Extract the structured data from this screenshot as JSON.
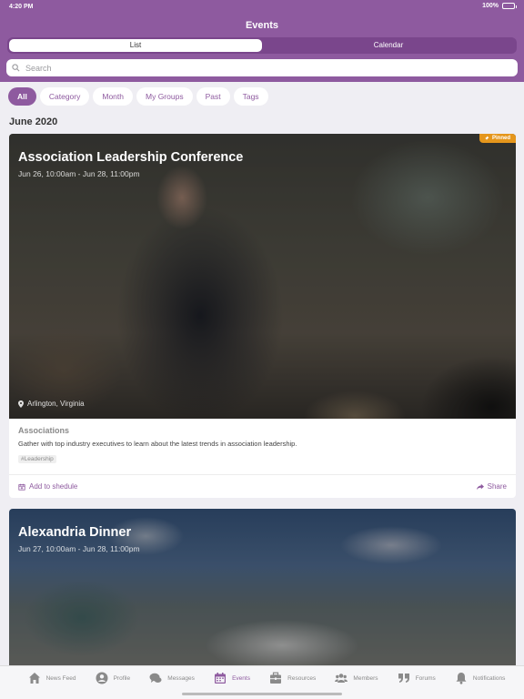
{
  "status": {
    "time": "4:20 PM",
    "battery": "100%"
  },
  "header": {
    "title": "Events"
  },
  "segment": {
    "list": "List",
    "calendar": "Calendar"
  },
  "search": {
    "placeholder": "Search"
  },
  "filters": [
    "All",
    "Category",
    "Month",
    "My Groups",
    "Past",
    "Tags"
  ],
  "month_heading": "June 2020",
  "events": [
    {
      "title": "Association Leadership Conference",
      "dates": "Jun 26, 10:00am - Jun 28, 11:00pm",
      "pinned_label": "Pinned",
      "location": "Arlington, Virginia",
      "category": "Associations",
      "description": "Gather with top industry executives to learn about the latest trends in association leadership.",
      "tag": "#Leadership",
      "add_label": "Add to shedule",
      "share_label": "Share"
    },
    {
      "title": "Alexandria Dinner",
      "dates": "Jun 27, 10:00am - Jun 28, 11:00pm"
    }
  ],
  "tabbar": [
    {
      "label": "News Feed",
      "icon": "home-icon"
    },
    {
      "label": "Profile",
      "icon": "person-icon"
    },
    {
      "label": "Messages",
      "icon": "chat-icon"
    },
    {
      "label": "Events",
      "icon": "calendar-icon",
      "active": true
    },
    {
      "label": "Resources",
      "icon": "briefcase-icon"
    },
    {
      "label": "Members",
      "icon": "people-icon"
    },
    {
      "label": "Forums",
      "icon": "quote-icon"
    },
    {
      "label": "Notifications",
      "icon": "bell-icon"
    }
  ],
  "colors": {
    "accent": "#8e5a9f",
    "pinned": "#e5961c"
  }
}
